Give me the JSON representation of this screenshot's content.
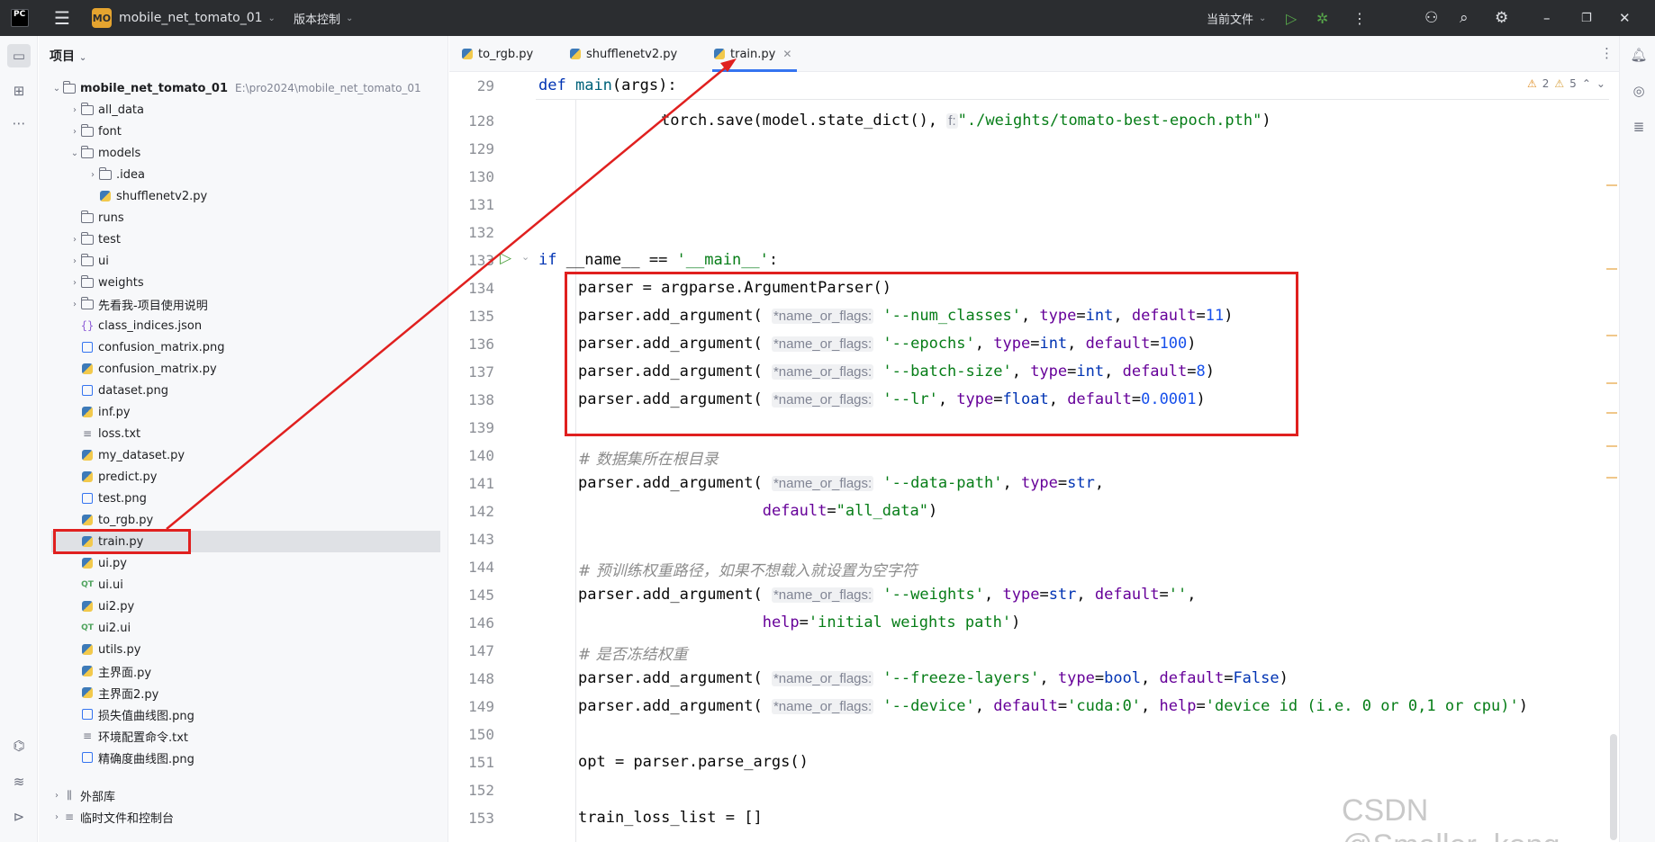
{
  "titlebar": {
    "logo": "PC",
    "project_badge": "MO",
    "project_name": "mobile_net_tomato_01",
    "vcs_label": "版本控制",
    "current_file_label": "当前文件"
  },
  "project_panel": {
    "title": "项目",
    "root": {
      "name": "mobile_net_tomato_01",
      "path": "E:\\pro2024\\mobile_net_tomato_01"
    },
    "items": [
      {
        "label": "all_data",
        "icon": "folder-icon"
      },
      {
        "label": "font",
        "icon": "folder-icon"
      },
      {
        "label": "models",
        "icon": "folder-icon"
      },
      {
        "label": ".idea",
        "icon": "folder-icon"
      },
      {
        "label": "shufflenetv2.py",
        "icon": "python-file-icon"
      },
      {
        "label": "runs",
        "icon": "folder-icon"
      },
      {
        "label": "test",
        "icon": "folder-icon"
      },
      {
        "label": "ui",
        "icon": "folder-icon"
      },
      {
        "label": "weights",
        "icon": "folder-icon"
      },
      {
        "label": "先看我-项目使用说明",
        "icon": "folder-icon"
      },
      {
        "label": "class_indices.json",
        "icon": "json-file-icon"
      },
      {
        "label": "confusion_matrix.png",
        "icon": "image-file-icon"
      },
      {
        "label": "confusion_matrix.py",
        "icon": "python-file-icon"
      },
      {
        "label": "dataset.png",
        "icon": "image-file-icon"
      },
      {
        "label": "inf.py",
        "icon": "python-file-icon"
      },
      {
        "label": "loss.txt",
        "icon": "text-file-icon"
      },
      {
        "label": "my_dataset.py",
        "icon": "python-file-icon"
      },
      {
        "label": "predict.py",
        "icon": "python-file-icon"
      },
      {
        "label": "test.png",
        "icon": "image-file-icon"
      },
      {
        "label": "to_rgb.py",
        "icon": "python-file-icon"
      },
      {
        "label": "train.py",
        "icon": "python-file-icon"
      },
      {
        "label": "ui.py",
        "icon": "python-file-icon"
      },
      {
        "label": "ui.ui",
        "icon": "qt-ui-file-icon"
      },
      {
        "label": "ui2.py",
        "icon": "python-file-icon"
      },
      {
        "label": "ui2.ui",
        "icon": "qt-ui-file-icon"
      },
      {
        "label": "utils.py",
        "icon": "python-file-icon"
      },
      {
        "label": "主界面.py",
        "icon": "python-file-icon"
      },
      {
        "label": "主界面2.py",
        "icon": "python-file-icon"
      },
      {
        "label": "损失值曲线图.png",
        "icon": "image-file-icon"
      },
      {
        "label": "环境配置命令.txt",
        "icon": "text-file-icon"
      },
      {
        "label": "精确度曲线图.png",
        "icon": "image-file-icon"
      }
    ],
    "external_libraries": "外部库",
    "scratches": "临时文件和控制台"
  },
  "tabs": [
    {
      "label": "to_rgb.py"
    },
    {
      "label": "shufflenetv2.py"
    },
    {
      "label": "train.py"
    }
  ],
  "editor": {
    "warnings": "2",
    "weak_warnings": "5",
    "sticky": {
      "line": "29",
      "kw": "def",
      "fn": "main",
      "rest": "(args):"
    },
    "lines": [
      {
        "n": "128",
        "a": "torch.save(model.state_dict(), ",
        "hint": "f:",
        "s": "\"./weights/tomato-best-epoch.pth\"",
        "b": ")"
      },
      {
        "n": "129"
      },
      {
        "n": "130"
      },
      {
        "n": "131"
      },
      {
        "n": "132"
      },
      {
        "n": "133",
        "kw": "if",
        "a": " __name__ == ",
        "s": "'__main__'",
        "b": ":"
      },
      {
        "n": "134",
        "a": "parser = argparse.ArgumentParser()"
      },
      {
        "n": "135",
        "a": "parser.add_argument( ",
        "hint": "*name_or_flags:",
        "s": " '--num_classes'",
        "b": ", ",
        "k1": "type",
        "v1": "=int",
        "sep": ", ",
        "k2": "default",
        "eq": "=",
        "num": "11",
        "end": ")"
      },
      {
        "n": "136",
        "a": "parser.add_argument( ",
        "hint": "*name_or_flags:",
        "s": " '--epochs'",
        "b": ", ",
        "k1": "type",
        "v1": "=int",
        "sep": ", ",
        "k2": "default",
        "eq": "=",
        "num": "100",
        "end": ")"
      },
      {
        "n": "137",
        "a": "parser.add_argument( ",
        "hint": "*name_or_flags:",
        "s": " '--batch-size'",
        "b": ", ",
        "k1": "type",
        "v1": "=int",
        "sep": ", ",
        "k2": "default",
        "eq": "=",
        "num": "8",
        "end": ")"
      },
      {
        "n": "138",
        "a": "parser.add_argument( ",
        "hint": "*name_or_flags:",
        "s": " '--lr'",
        "b": ", ",
        "k1": "type",
        "v1": "=float",
        "sep": ", ",
        "k2": "default",
        "eq": "=",
        "num": "0.0001",
        "end": ")"
      },
      {
        "n": "139"
      },
      {
        "n": "140",
        "cm": "# 数据集所在根目录"
      },
      {
        "n": "141",
        "a": "parser.add_argument( ",
        "hint": "*name_or_flags:",
        "s": " '--data-path'",
        "b": ", ",
        "k1": "type",
        "v1": "=str",
        "sep": ","
      },
      {
        "n": "142",
        "pad": "                    ",
        "k1": "default",
        "v1": "=",
        "s2": "\"all_data\"",
        "end": ")"
      },
      {
        "n": "143"
      },
      {
        "n": "144",
        "cm": "# 预训练权重路径，如果不想载入就设置为空字符"
      },
      {
        "n": "145",
        "a": "parser.add_argument( ",
        "hint": "*name_or_flags:",
        "s": " '--weights'",
        "b": ", ",
        "k1": "type",
        "v1": "=str",
        "sep": ", ",
        "k2": "default",
        "eq": "=",
        "s3": "''",
        "end": ","
      },
      {
        "n": "146",
        "pad": "                    ",
        "k1": "help",
        "v1": "=",
        "s2": "'initial weights path'",
        "end": ")"
      },
      {
        "n": "147",
        "cm": "# 是否冻结权重"
      },
      {
        "n": "148",
        "a": "parser.add_argument( ",
        "hint": "*name_or_flags:",
        "s": " '--freeze-layers'",
        "b": ", ",
        "k1": "type",
        "v1": "=bool",
        "sep": ", ",
        "k2": "default",
        "eq": "=",
        "kwv": "False",
        "end": ")"
      },
      {
        "n": "149",
        "a": "parser.add_argument( ",
        "hint": "*name_or_flags:",
        "s": " '--device'",
        "b": ", ",
        "k1": "default",
        "v1": "=",
        "s2": "'cuda:0'",
        "sep": ", ",
        "k2": "help",
        "eq": "=",
        "s3": "'device id (i.e. 0 or 0,1 or cpu)'",
        "end": ")"
      },
      {
        "n": "150"
      },
      {
        "n": "151",
        "a": "opt = parser.parse_args()"
      },
      {
        "n": "152"
      },
      {
        "n": "153",
        "a": "train_loss_list = []"
      }
    ]
  },
  "watermark": "CSDN @Smaller_kong",
  "colors": {
    "highlight_box": "#e0201f",
    "accent": "#3574f0"
  }
}
